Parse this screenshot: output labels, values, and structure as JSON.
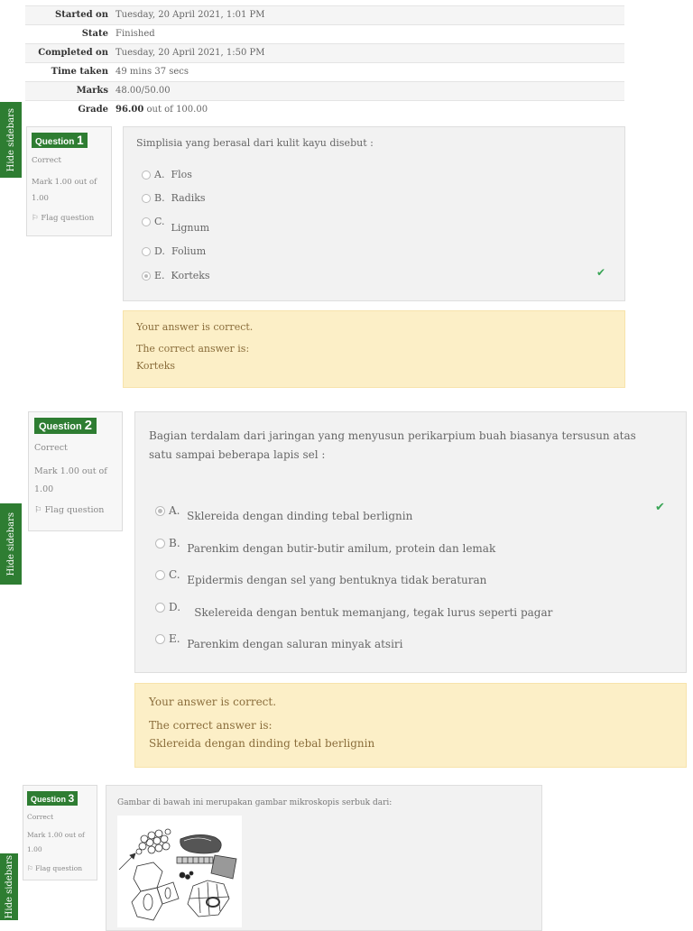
{
  "summary": [
    {
      "label": "Started on",
      "value": "Tuesday, 20 April 2021, 1:01 PM"
    },
    {
      "label": "State",
      "value": "Finished"
    },
    {
      "label": "Completed on",
      "value": "Tuesday, 20 April 2021, 1:50 PM"
    },
    {
      "label": "Time taken",
      "value": "49 mins 37 secs"
    },
    {
      "label": "Marks",
      "value": "48.00/50.00"
    },
    {
      "label": "Grade",
      "value_bold": "96.00",
      "value_rest": " out of 100.00"
    }
  ],
  "sidebar_label": "Hide sidebars",
  "questions": [
    {
      "prefix": "Question",
      "number": "1",
      "status": "Correct",
      "mark": "Mark 1.00 out of 1.00",
      "flag": "Flag question",
      "text": "Simplisia yang berasal dari kulit kayu disebut :",
      "options": [
        {
          "letter": "A.",
          "text": "Flos"
        },
        {
          "letter": "B.",
          "text": "Radiks"
        },
        {
          "letter": "C.",
          "text": "Lignum"
        },
        {
          "letter": "D.",
          "text": "Folium"
        },
        {
          "letter": "E.",
          "text": "Korteks"
        }
      ],
      "selected": "E",
      "feedback": {
        "verdict": "Your answer is correct.",
        "correct_label": "The correct answer is:",
        "correct_value": "Korteks"
      }
    },
    {
      "prefix": "Question",
      "number": "2",
      "status": "Correct",
      "mark": "Mark 1.00 out of 1.00",
      "flag": "Flag question",
      "text": "Bagian  terdalam dari jaringan yang menyusun perikarpium buah biasanya tersusun atas satu sampai beberapa lapis sel :",
      "options": [
        {
          "letter": "A.",
          "text": "Sklereida dengan dinding tebal berlignin"
        },
        {
          "letter": "B.",
          "text": "Parenkim dengan butir-butir amilum, protein dan lemak"
        },
        {
          "letter": "C.",
          "text": "Epidermis dengan sel yang bentuknya tidak beraturan"
        },
        {
          "letter": "D.",
          "text": "Skelereida dengan bentuk memanjang, tegak lurus seperti pagar"
        },
        {
          "letter": "E.",
          "text": "Parenkim dengan saluran minyak atsiri"
        }
      ],
      "selected": "A",
      "feedback": {
        "verdict": "Your answer is correct.",
        "correct_label": "The correct answer is:",
        "correct_value": "Sklereida dengan dinding tebal berlignin"
      }
    },
    {
      "prefix": "Question",
      "number": "3",
      "status": "Correct",
      "mark": "Mark 1.00 out of 1.00",
      "flag": "Flag question",
      "text": "Gambar di bawah ini merupakan gambar mikroskopis serbuk dari:"
    }
  ],
  "icons": {
    "check": "check-icon",
    "flag": "flag-icon",
    "arrow": "arrow-icon"
  },
  "colors": {
    "sidebar": "#2e7d32",
    "check": "#3aa556",
    "feedback_bg": "#fcefc7",
    "feedback_text": "#8a6d3b"
  }
}
